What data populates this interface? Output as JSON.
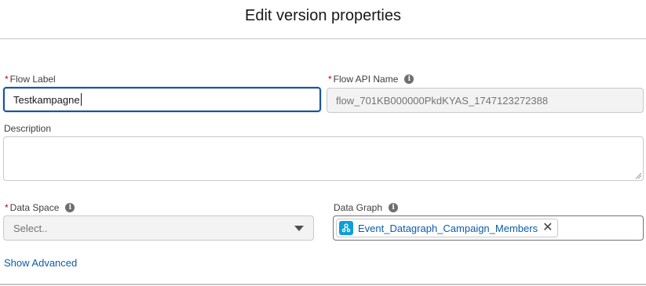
{
  "modal": {
    "title": "Edit version properties"
  },
  "fields": {
    "flow_label": {
      "label": "Flow Label",
      "required_marker": "*",
      "value": "Testkampagne"
    },
    "flow_api_name": {
      "label": "Flow API Name",
      "required_marker": "*",
      "value": "flow_701KB000000PkdKYAS_1747123272388",
      "info_icon": "info-icon"
    },
    "description": {
      "label": "Description",
      "value": ""
    },
    "data_space": {
      "label": "Data Space",
      "required_marker": "*",
      "placeholder": "Select..",
      "info_icon": "info-icon"
    },
    "data_graph": {
      "label": "Data Graph",
      "info_icon": "info-icon",
      "pill_label": "Event_Datagraph_Campaign_Members",
      "remove_glyph": "✕"
    }
  },
  "links": {
    "show_advanced": "Show Advanced"
  },
  "colors": {
    "focus_border": "#1b5297",
    "required": "#ba0517",
    "link": "#0b5cab",
    "pill_icon_bg": "#0d9dda"
  }
}
